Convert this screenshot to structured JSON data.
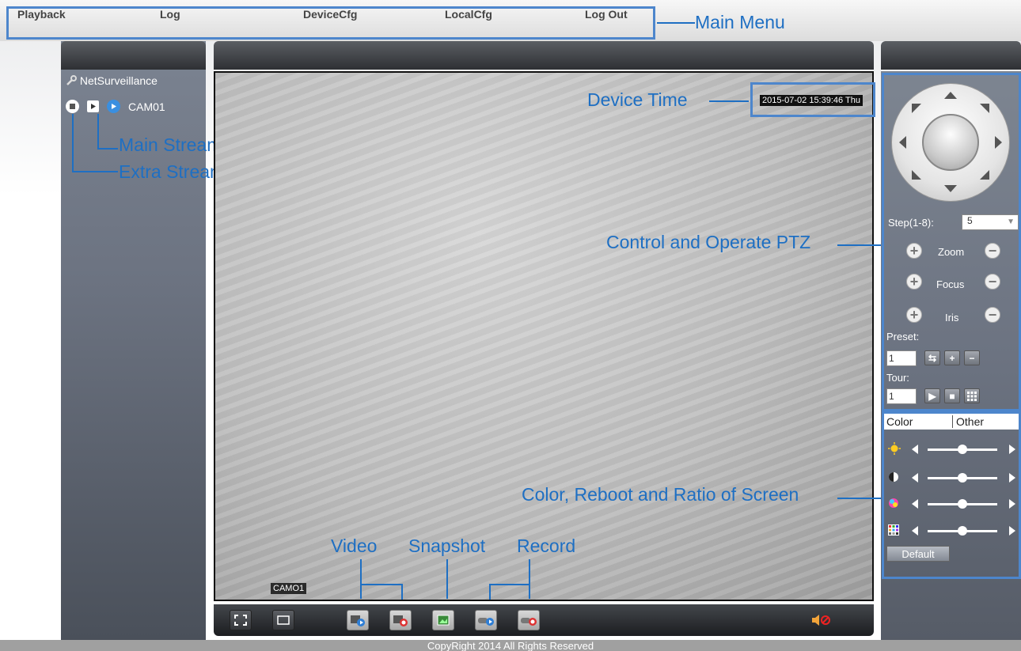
{
  "menu": {
    "items": [
      "Playback",
      "Log",
      "DeviceCfg",
      "LocalCfg",
      "Log Out"
    ]
  },
  "annotations": {
    "main_menu": "Main Menu",
    "device_time": "Device Time",
    "main_stream": "Main Stream",
    "extra_stream": "Extra Stream",
    "ptz": "Control and Operate PTZ",
    "color": "Color, Reboot and Ratio of Screen",
    "video": "Video",
    "snapshot": "Snapshot",
    "record": "Record"
  },
  "device_tree": {
    "root": "NetSurveillance",
    "camera": "CAM01"
  },
  "video": {
    "timestamp": "2015-07-02 15:39:46 Thu",
    "channel_label": "CAMO1"
  },
  "ptz": {
    "step_label": "Step(1-8):",
    "step_value": "5",
    "zoom_label": "Zoom",
    "focus_label": "Focus",
    "iris_label": "Iris",
    "preset_label": "Preset:",
    "preset_value": "1",
    "tour_label": "Tour:",
    "tour_value": "1"
  },
  "image_settings": {
    "tabs": [
      "Color",
      "Other"
    ],
    "slider_levels": [
      0.5,
      0.5,
      0.5,
      0.5
    ],
    "default_label": "Default"
  },
  "footer": "CopyRight 2014 All Rights Reserved",
  "colors": {
    "annotation_blue": "#1e6fc3",
    "highlight_border": "#4d86cc"
  }
}
